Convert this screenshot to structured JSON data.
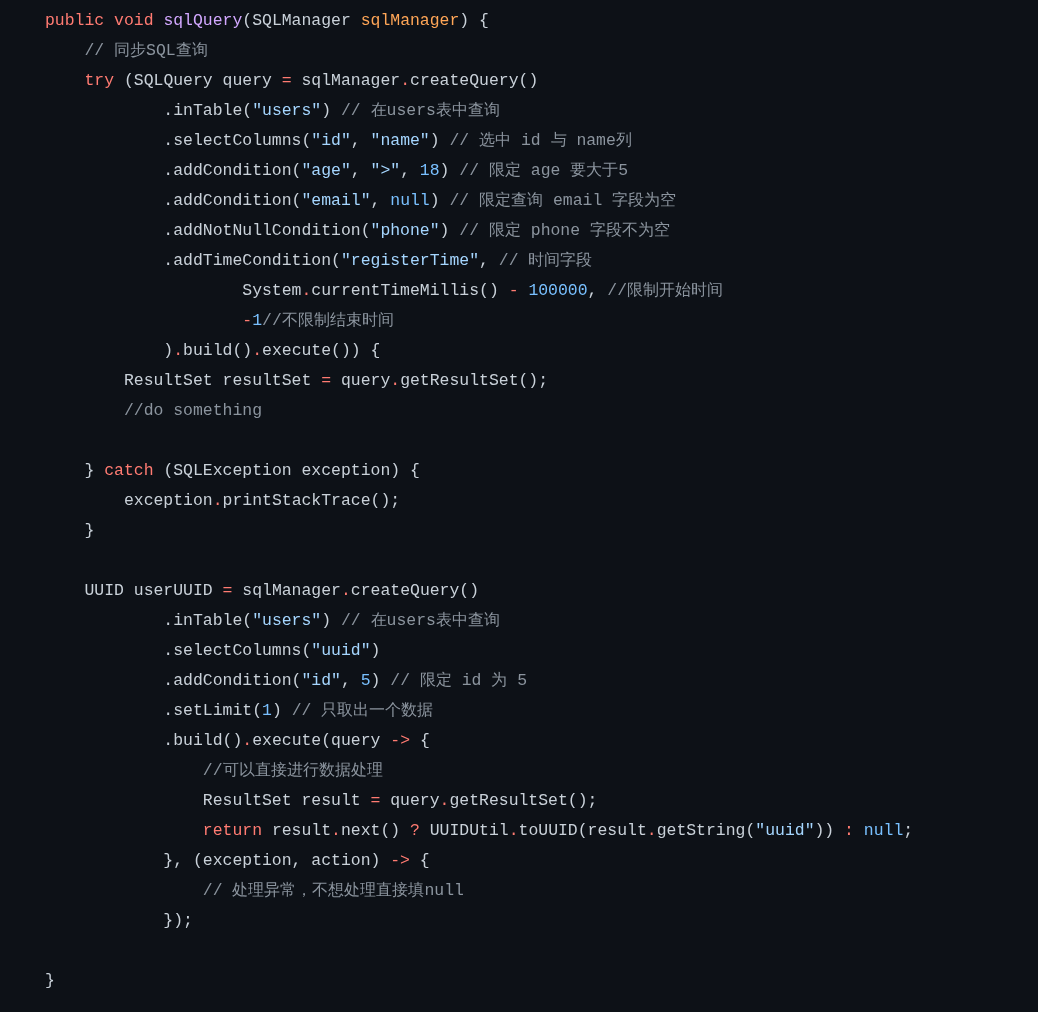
{
  "code_lines": [
    {
      "kind": "code",
      "tokens": [
        {
          "kind": "keyword",
          "text": "public void "
        },
        {
          "kind": "function",
          "text": "sqlQuery"
        },
        {
          "kind": "plain",
          "text": "(SQLManager "
        },
        {
          "kind": "param",
          "text": "sqlManager"
        },
        {
          "kind": "plain",
          "text": ") {"
        }
      ]
    },
    {
      "kind": "code",
      "tokens": [
        {
          "kind": "comment",
          "text": "    // 同步SQL查询"
        }
      ]
    },
    {
      "kind": "code",
      "tokens": [
        {
          "kind": "keyword",
          "text": "    try"
        },
        {
          "kind": "plain",
          "text": " (SQLQuery query "
        },
        {
          "kind": "operator",
          "text": "="
        },
        {
          "kind": "plain",
          "text": " sqlManager"
        },
        {
          "kind": "operator",
          "text": "."
        },
        {
          "kind": "plain",
          "text": "createQuery()"
        }
      ]
    },
    {
      "kind": "code",
      "tokens": [
        {
          "kind": "plain",
          "text": "            .inTable("
        },
        {
          "kind": "string",
          "text": "\"users\""
        },
        {
          "kind": "plain",
          "text": ") "
        },
        {
          "kind": "comment",
          "text": "// 在users表中查询"
        }
      ]
    },
    {
      "kind": "code",
      "tokens": [
        {
          "kind": "plain",
          "text": "            .selectColumns("
        },
        {
          "kind": "string",
          "text": "\"id\""
        },
        {
          "kind": "plain",
          "text": ", "
        },
        {
          "kind": "string",
          "text": "\"name\""
        },
        {
          "kind": "plain",
          "text": ") "
        },
        {
          "kind": "comment",
          "text": "// 选中 id 与 name列"
        }
      ]
    },
    {
      "kind": "code",
      "tokens": [
        {
          "kind": "plain",
          "text": "            .addCondition("
        },
        {
          "kind": "string",
          "text": "\"age\""
        },
        {
          "kind": "plain",
          "text": ", "
        },
        {
          "kind": "string",
          "text": "\">\""
        },
        {
          "kind": "plain",
          "text": ", "
        },
        {
          "kind": "number",
          "text": "18"
        },
        {
          "kind": "plain",
          "text": ") "
        },
        {
          "kind": "comment",
          "text": "// 限定 age 要大于5"
        }
      ]
    },
    {
      "kind": "code",
      "tokens": [
        {
          "kind": "plain",
          "text": "            .addCondition("
        },
        {
          "kind": "string",
          "text": "\"email\""
        },
        {
          "kind": "plain",
          "text": ", "
        },
        {
          "kind": "number",
          "text": "null"
        },
        {
          "kind": "plain",
          "text": ") "
        },
        {
          "kind": "comment",
          "text": "// 限定查询 email 字段为空"
        }
      ]
    },
    {
      "kind": "code",
      "tokens": [
        {
          "kind": "plain",
          "text": "            .addNotNullCondition("
        },
        {
          "kind": "string",
          "text": "\"phone\""
        },
        {
          "kind": "plain",
          "text": ") "
        },
        {
          "kind": "comment",
          "text": "// 限定 phone 字段不为空"
        }
      ]
    },
    {
      "kind": "code",
      "tokens": [
        {
          "kind": "plain",
          "text": "            .addTimeCondition("
        },
        {
          "kind": "string",
          "text": "\"registerTime\""
        },
        {
          "kind": "plain",
          "text": ", "
        },
        {
          "kind": "comment",
          "text": "// 时间字段"
        }
      ]
    },
    {
      "kind": "code",
      "tokens": [
        {
          "kind": "plain",
          "text": "                    System"
        },
        {
          "kind": "operator",
          "text": "."
        },
        {
          "kind": "plain",
          "text": "currentTimeMillis() "
        },
        {
          "kind": "operator",
          "text": "- "
        },
        {
          "kind": "number",
          "text": "100000"
        },
        {
          "kind": "plain",
          "text": ", "
        },
        {
          "kind": "comment",
          "text": "//限制开始时间"
        }
      ]
    },
    {
      "kind": "code",
      "tokens": [
        {
          "kind": "operator",
          "text": "                    -"
        },
        {
          "kind": "number",
          "text": "1"
        },
        {
          "kind": "comment",
          "text": "//不限制结束时间"
        }
      ]
    },
    {
      "kind": "code",
      "tokens": [
        {
          "kind": "plain",
          "text": "            )"
        },
        {
          "kind": "operator",
          "text": "."
        },
        {
          "kind": "plain",
          "text": "build()"
        },
        {
          "kind": "operator",
          "text": "."
        },
        {
          "kind": "plain",
          "text": "execute()) {"
        }
      ]
    },
    {
      "kind": "code",
      "tokens": [
        {
          "kind": "plain",
          "text": "        ResultSet resultSet "
        },
        {
          "kind": "operator",
          "text": "="
        },
        {
          "kind": "plain",
          "text": " query"
        },
        {
          "kind": "operator",
          "text": "."
        },
        {
          "kind": "plain",
          "text": "getResultSet();"
        }
      ]
    },
    {
      "kind": "code",
      "tokens": [
        {
          "kind": "comment",
          "text": "        //do something"
        }
      ]
    },
    {
      "kind": "blank"
    },
    {
      "kind": "code",
      "tokens": [
        {
          "kind": "plain",
          "text": "    } "
        },
        {
          "kind": "keyword",
          "text": "catch"
        },
        {
          "kind": "plain",
          "text": " (SQLException exception) {"
        }
      ]
    },
    {
      "kind": "code",
      "tokens": [
        {
          "kind": "plain",
          "text": "        exception"
        },
        {
          "kind": "operator",
          "text": "."
        },
        {
          "kind": "plain",
          "text": "printStackTrace();"
        }
      ]
    },
    {
      "kind": "code",
      "tokens": [
        {
          "kind": "plain",
          "text": "    }"
        }
      ]
    },
    {
      "kind": "blank"
    },
    {
      "kind": "code",
      "tokens": [
        {
          "kind": "plain",
          "text": "    UUID userUUID "
        },
        {
          "kind": "operator",
          "text": "="
        },
        {
          "kind": "plain",
          "text": " sqlManager"
        },
        {
          "kind": "operator",
          "text": "."
        },
        {
          "kind": "plain",
          "text": "createQuery()"
        }
      ]
    },
    {
      "kind": "code",
      "tokens": [
        {
          "kind": "plain",
          "text": "            .inTable("
        },
        {
          "kind": "string",
          "text": "\"users\""
        },
        {
          "kind": "plain",
          "text": ") "
        },
        {
          "kind": "comment",
          "text": "// 在users表中查询"
        }
      ]
    },
    {
      "kind": "code",
      "tokens": [
        {
          "kind": "plain",
          "text": "            .selectColumns("
        },
        {
          "kind": "string",
          "text": "\"uuid\""
        },
        {
          "kind": "plain",
          "text": ")"
        }
      ]
    },
    {
      "kind": "code",
      "tokens": [
        {
          "kind": "plain",
          "text": "            .addCondition("
        },
        {
          "kind": "string",
          "text": "\"id\""
        },
        {
          "kind": "plain",
          "text": ", "
        },
        {
          "kind": "number",
          "text": "5"
        },
        {
          "kind": "plain",
          "text": ") "
        },
        {
          "kind": "comment",
          "text": "// 限定 id 为 5"
        }
      ]
    },
    {
      "kind": "code",
      "tokens": [
        {
          "kind": "plain",
          "text": "            .setLimit("
        },
        {
          "kind": "number",
          "text": "1"
        },
        {
          "kind": "plain",
          "text": ") "
        },
        {
          "kind": "comment",
          "text": "// 只取出一个数据"
        }
      ]
    },
    {
      "kind": "code",
      "tokens": [
        {
          "kind": "plain",
          "text": "            .build()"
        },
        {
          "kind": "operator",
          "text": "."
        },
        {
          "kind": "plain",
          "text": "execute(query "
        },
        {
          "kind": "operator",
          "text": "->"
        },
        {
          "kind": "plain",
          "text": " {"
        }
      ]
    },
    {
      "kind": "code",
      "tokens": [
        {
          "kind": "comment",
          "text": "                //可以直接进行数据处理"
        }
      ]
    },
    {
      "kind": "code",
      "tokens": [
        {
          "kind": "plain",
          "text": "                ResultSet result "
        },
        {
          "kind": "operator",
          "text": "="
        },
        {
          "kind": "plain",
          "text": " query"
        },
        {
          "kind": "operator",
          "text": "."
        },
        {
          "kind": "plain",
          "text": "getResultSet();"
        }
      ]
    },
    {
      "kind": "code",
      "tokens": [
        {
          "kind": "keyword",
          "text": "                return"
        },
        {
          "kind": "plain",
          "text": " result"
        },
        {
          "kind": "operator",
          "text": "."
        },
        {
          "kind": "plain",
          "text": "next() "
        },
        {
          "kind": "operator",
          "text": "?"
        },
        {
          "kind": "plain",
          "text": " UUIDUtil"
        },
        {
          "kind": "operator",
          "text": "."
        },
        {
          "kind": "plain",
          "text": "toUUID(result"
        },
        {
          "kind": "operator",
          "text": "."
        },
        {
          "kind": "plain",
          "text": "getString("
        },
        {
          "kind": "string",
          "text": "\"uuid\""
        },
        {
          "kind": "plain",
          "text": ")) "
        },
        {
          "kind": "operator",
          "text": ": "
        },
        {
          "kind": "number",
          "text": "null"
        },
        {
          "kind": "plain",
          "text": ";"
        }
      ]
    },
    {
      "kind": "code",
      "tokens": [
        {
          "kind": "plain",
          "text": "            }, (exception, action) "
        },
        {
          "kind": "operator",
          "text": "->"
        },
        {
          "kind": "plain",
          "text": " {"
        }
      ]
    },
    {
      "kind": "code",
      "tokens": [
        {
          "kind": "comment",
          "text": "                // 处理异常，不想处理直接填null"
        }
      ]
    },
    {
      "kind": "code",
      "tokens": [
        {
          "kind": "plain",
          "text": "            });"
        }
      ]
    },
    {
      "kind": "blank"
    },
    {
      "kind": "code",
      "tokens": [
        {
          "kind": "plain",
          "text": "}"
        }
      ]
    }
  ]
}
